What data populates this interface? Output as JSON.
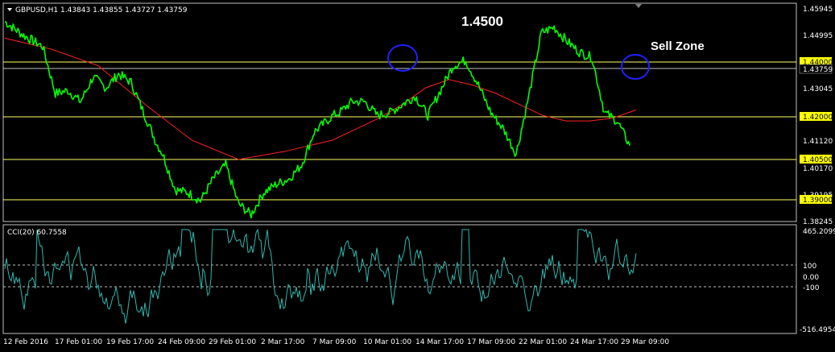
{
  "header": {
    "menu_icon": "triangle-down-icon",
    "symbol_label": "GBPUSD,H1  1.43843 1.43855 1.43727 1.43759",
    "indicator_label": "CCI(20) 60.7558"
  },
  "annotations": {
    "level_title": "1.4500",
    "sell_zone": "Sell Zone"
  },
  "colors": {
    "background": "#000000",
    "price_line": "#00ff00",
    "moving_average": "#ff0000",
    "cci_line": "#20b2aa",
    "level_line": "#ffff00",
    "circle": "#1e1eff",
    "text": "#ffffff",
    "grid_frame": "#c0c0c0"
  },
  "price_axis": {
    "ticks": [
      "1.45945",
      "1.44995",
      "1.43045",
      "1.41120",
      "1.40170",
      "1.39195",
      "1.38245"
    ],
    "highlighted": [
      {
        "label": "1.44000",
        "style": "yellow"
      },
      {
        "label": "1.43759",
        "style": "black"
      },
      {
        "label": "1.42000",
        "style": "yellow"
      },
      {
        "label": "1.40500",
        "style": "yellow"
      },
      {
        "label": "1.39000",
        "style": "yellow"
      }
    ]
  },
  "cci_axis": {
    "ticks": [
      "465.2099",
      "100",
      "0.00",
      "-100",
      "-516.4954"
    ]
  },
  "time_axis": {
    "labels": [
      "12 Feb 2016",
      "17 Feb 01:00",
      "19 Feb 17:00",
      "24 Feb 09:00",
      "29 Feb 01:00",
      "2 Mar 17:00",
      "7 Mar 09:00",
      "10 Mar 01:00",
      "14 Mar 17:00",
      "17 Mar 09:00",
      "22 Mar 01:00",
      "24 Mar 17:00",
      "29 Mar 09:00"
    ]
  },
  "chart_data": {
    "type": "line",
    "title": "GBPUSD,H1",
    "ylim": [
      1.3818,
      1.4604
    ],
    "horizontal_levels": [
      1.44,
      1.4376,
      1.42,
      1.405,
      1.39
    ],
    "series": [
      {
        "name": "GBPUSD,H1",
        "x": [
          0,
          3,
          6,
          8,
          10,
          12,
          14,
          16,
          18,
          20,
          22,
          24,
          25,
          27,
          29,
          31,
          33,
          35,
          37,
          39,
          41,
          43,
          45,
          47,
          49,
          51,
          52,
          53,
          55,
          57,
          59,
          61,
          63,
          65,
          67,
          69,
          71,
          73,
          75,
          77,
          79,
          81,
          83,
          85,
          87,
          89,
          91,
          93,
          95,
          97,
          99
        ],
        "values": [
          1.454,
          1.449,
          1.445,
          1.428,
          1.429,
          1.425,
          1.434,
          1.43,
          1.435,
          1.432,
          1.421,
          1.41,
          1.406,
          1.393,
          1.392,
          1.389,
          1.397,
          1.402,
          1.388,
          1.384,
          1.392,
          1.395,
          1.397,
          1.402,
          1.414,
          1.418,
          1.42,
          1.421,
          1.425,
          1.425,
          1.42,
          1.421,
          1.424,
          1.427,
          1.42,
          1.429,
          1.438,
          1.44,
          1.431,
          1.421,
          1.415,
          1.406,
          1.427,
          1.45,
          1.452,
          1.447,
          1.443,
          1.441,
          1.421,
          1.418,
          1.409
        ]
      },
      {
        "name": "MA",
        "x": [
          0,
          10,
          20,
          30,
          40,
          50,
          60,
          70,
          75,
          80,
          85,
          90,
          95,
          100,
          105,
          110,
          115,
          120,
          125,
          130,
          135
        ],
        "values": [
          1.448,
          1.444,
          1.438,
          1.424,
          1.411,
          1.404,
          1.407,
          1.411,
          1.415,
          1.419,
          1.424,
          1.43,
          1.433,
          1.431,
          1.428,
          1.424,
          1.42,
          1.418,
          1.418,
          1.419,
          1.422
        ]
      }
    ]
  }
}
